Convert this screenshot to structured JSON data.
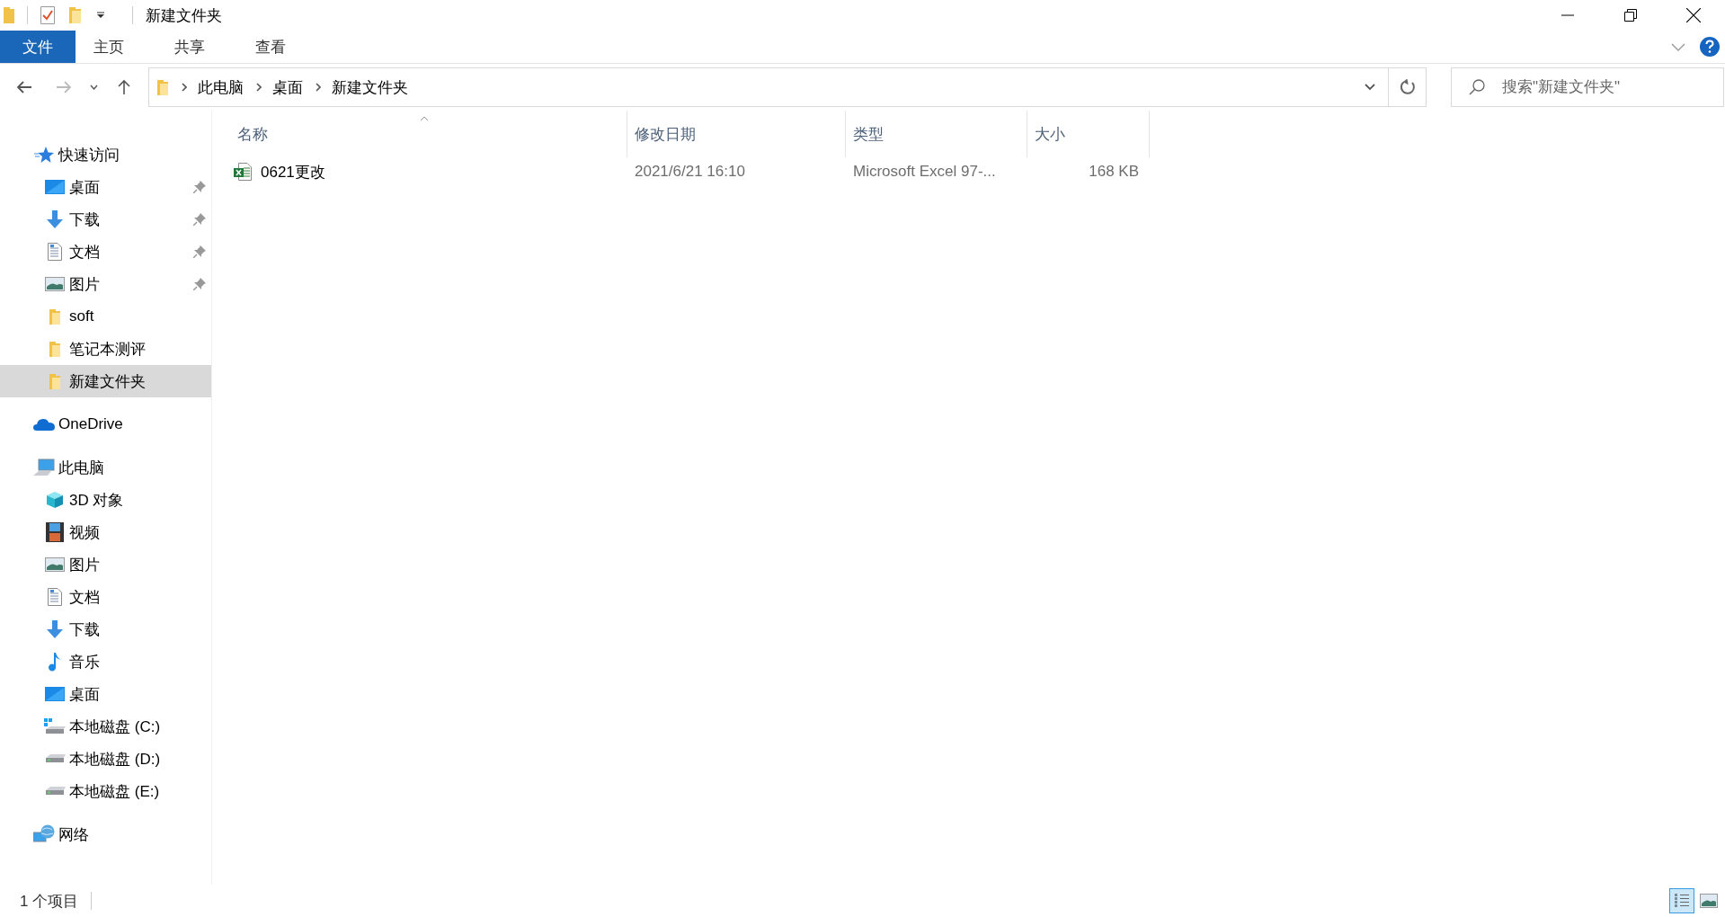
{
  "window": {
    "title": "新建文件夹"
  },
  "ribbon": {
    "tabs": [
      {
        "label": "文件",
        "kind": "menu"
      },
      {
        "label": "主页",
        "kind": "tab"
      },
      {
        "label": "共享",
        "kind": "tab"
      },
      {
        "label": "查看",
        "kind": "tab"
      }
    ]
  },
  "address_bar": {
    "crumbs": [
      "此电脑",
      "桌面",
      "新建文件夹"
    ]
  },
  "search": {
    "placeholder": "搜索\"新建文件夹\""
  },
  "sidebar": {
    "items": [
      {
        "label": "快速访问",
        "kind": "star",
        "selected": false,
        "children": [
          {
            "label": "桌面",
            "kind": "desktop",
            "selected": false,
            "pinned": true
          },
          {
            "label": "下载",
            "kind": "download",
            "selected": false,
            "pinned": true
          },
          {
            "label": "文档",
            "kind": "document",
            "selected": false,
            "pinned": true
          },
          {
            "label": "图片",
            "kind": "picture",
            "selected": false,
            "pinned": true
          },
          {
            "label": "soft",
            "kind": "folder",
            "selected": false,
            "pinned": false
          },
          {
            "label": "笔记本测评",
            "kind": "folder",
            "selected": false,
            "pinned": false
          },
          {
            "label": "新建文件夹",
            "kind": "folder",
            "selected": true,
            "pinned": false
          }
        ]
      },
      {
        "label": "OneDrive",
        "kind": "cloud",
        "selected": false
      },
      {
        "label": "此电脑",
        "kind": "pc",
        "selected": false,
        "children": [
          {
            "label": "3D 对象",
            "kind": "cube",
            "selected": false
          },
          {
            "label": "视频",
            "kind": "film",
            "selected": false
          },
          {
            "label": "图片",
            "kind": "picture",
            "selected": false
          },
          {
            "label": "文档",
            "kind": "document",
            "selected": false
          },
          {
            "label": "下载",
            "kind": "download",
            "selected": false
          },
          {
            "label": "音乐",
            "kind": "music",
            "selected": false
          },
          {
            "label": "桌面",
            "kind": "desktop",
            "selected": false
          },
          {
            "label": "本地磁盘 (C:)",
            "kind": "system_drive",
            "selected": false
          },
          {
            "label": "本地磁盘 (D:)",
            "kind": "drive",
            "selected": false
          },
          {
            "label": "本地磁盘 (E:)",
            "kind": "drive",
            "selected": false
          }
        ]
      },
      {
        "label": "网络",
        "kind": "network",
        "selected": false
      }
    ]
  },
  "table": {
    "columns": [
      {
        "label": "名称",
        "sorted": true
      },
      {
        "label": "修改日期",
        "sorted": false
      },
      {
        "label": "类型",
        "sorted": false
      },
      {
        "label": "大小",
        "sorted": false
      }
    ],
    "rows": [
      {
        "name": "0621更改",
        "date": "2021/6/21 16:10",
        "type": "Microsoft Excel 97-...",
        "size": "168 KB",
        "kind": "excel"
      }
    ]
  },
  "status_bar": {
    "count": "1 个项目",
    "views": [
      {
        "kind": "details",
        "selected": true
      },
      {
        "kind": "large_icons",
        "selected": false
      }
    ]
  }
}
